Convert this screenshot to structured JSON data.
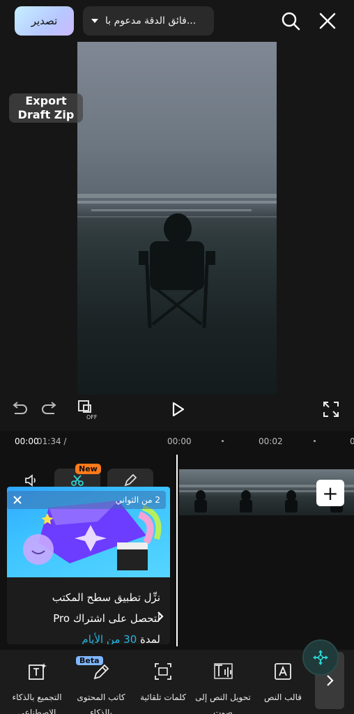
{
  "topbar": {
    "export_label": "تصدير",
    "resolution_label": "فائق الدقة مدعوم با...",
    "search_icon": "search-icon",
    "close_icon": "close-icon"
  },
  "preview": {
    "draft_zip_label_line1": "Export",
    "draft_zip_label_line2": "Draft Zip"
  },
  "controls": {
    "redo_icon": "redo-icon",
    "undo_icon": "undo-icon",
    "keyframe_off_icon": "keyframe-off-icon",
    "play_icon": "play-icon",
    "fullscreen_icon": "fullscreen-icon"
  },
  "ruler": {
    "current_time": "00:00",
    "total_time": "01:34 /",
    "tick_0": "00:00",
    "tick_1": "00:02",
    "tick_2": "0"
  },
  "timeline": {
    "new_badge": "New"
  },
  "promo": {
    "timer": "2 من الثواني",
    "line1": "نزِّل تطبيق سطح المكتب",
    "line2": "لتحصل على اشتراك Pro",
    "line3_prefix": "لمدة ",
    "line3_number": "30",
    "line3_suffix": " من الأيام"
  },
  "bottom_toolbar": {
    "beta_badge": "Beta",
    "tools": [
      {
        "label_line1": "التجميع بالذكاء",
        "label_line2": "الاصطناعي"
      },
      {
        "label_line1": "كاتب المحتوى",
        "label_line2": "بالذكاء الاصطناعي"
      },
      {
        "label_line1": "كلمات تلقائية",
        "label_line2": ""
      },
      {
        "label_line1": "تحويل النص إلى",
        "label_line2": "صوت"
      },
      {
        "label_line1": "قالب النص",
        "label_line2": ""
      }
    ]
  },
  "colors": {
    "accent": "#2dd4d4",
    "export_gradient_start": "#c6f0ff",
    "new_badge": "#ff7a1a",
    "beta_badge": "#7fb6ff",
    "promo_accent": "#27b6e0"
  }
}
